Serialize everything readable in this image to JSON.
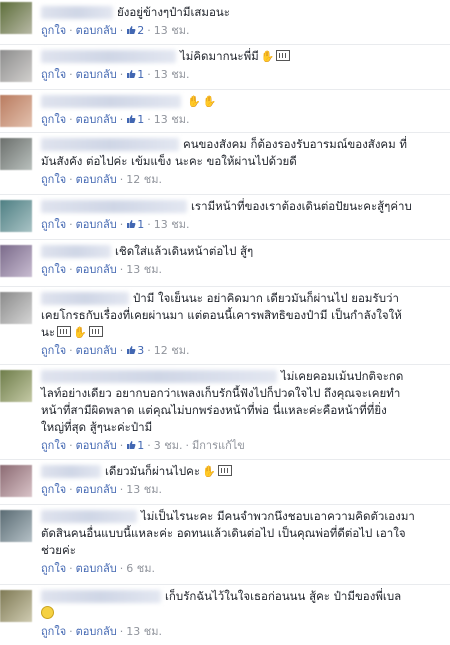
{
  "labels": {
    "like": "ถูกใจ",
    "reply": "ตอบกลับ",
    "edited": "มีการแก้ไข"
  },
  "comments": [
    {
      "lines": [
        "ยังอยู่ข้างๆป๋ามีเสมอนะ"
      ],
      "likes": "2",
      "time": "13 ชม."
    },
    {
      "lines": [
        "ไม่คิดมากนะพี่มี"
      ],
      "likes": "1",
      "time": "13 ชม."
    },
    {
      "lines": [
        ""
      ],
      "likes": "1",
      "time": "13 ชม."
    },
    {
      "lines": [
        "คนของสังคม ก็ต้องรองรับอารมณ์ของสังคม ที่",
        "มันสังคัง ต่อไปค่ะ เข้มแข็ง นะคะ ขอให้ผ่านไปด้วยดี"
      ],
      "likes": "",
      "time": "12 ชม."
    },
    {
      "lines": [
        "เรามีหน้าที่ของเราต้องเดินต่อปัยนะคะสู้ๆค่าบ"
      ],
      "likes": "1",
      "time": "13 ชม."
    },
    {
      "lines": [
        "เชิดใส่แล้วเดินหน้าต่อไป สู้ๆ"
      ],
      "likes": "",
      "time": "13 ชม."
    },
    {
      "lines": [
        "ป๋ามี ใจเย็นนะ อย่าคิดมาก เดียวมันก็ผ่านไป ยอมรับว่า",
        "เคยโกรธกับเรื่องที่เคยผ่านมา แต่ตอนนี้เคารพสิทธิของป๋ามี เป็นกำลังใจให้",
        "นะ"
      ],
      "likes": "3",
      "time": "12 ชม."
    },
    {
      "lines": [
        "ไม่เคยคอมเม้นปกติจะกด",
        "ไลท์อย่างเดียว อยากบอกว่าเพลงเก็บรักนี้ฟังไปก็ปวดใจไป ถึงคุณจะเคยทำ",
        "หน้าที่สามีผิดพลาด แต่คุณไม่บกพร่องหน้าที่พ่อ นี่แหละค่ะคือหน้าที่ที่ยิ่ง",
        "ใหญ่ที่สุด สู้ๆนะค่ะป๋ามี"
      ],
      "likes": "1",
      "time": "3 ชม.",
      "edited": true
    },
    {
      "lines": [
        "เดียวมันก็ผ่านไปคะ"
      ],
      "likes": "",
      "time": "13 ชม."
    },
    {
      "lines": [
        "ไม่เป็นไรนะคะ มีคนจำพวกนึงชอบเอาความคิดตัวเองมา",
        "ตัดสินคนอื่นแบบนี้แหละค่ะ อดทนแล้วเดินต่อไป เป็นคุณพ่อที่ดีต่อไป เอาใจ",
        "ช่วยค่ะ"
      ],
      "likes": "",
      "time": "6 ชม."
    },
    {
      "lines": [
        "เก็บรักฉันไว้ในใจเธอก่อนนน สู้คะ ป๋ามีของพี่เบล"
      ],
      "likes": "",
      "time": "13 ชม."
    }
  ],
  "colors": {
    "link": "#4267b2",
    "meta": "#90949c",
    "divider": "#e9ebee"
  }
}
